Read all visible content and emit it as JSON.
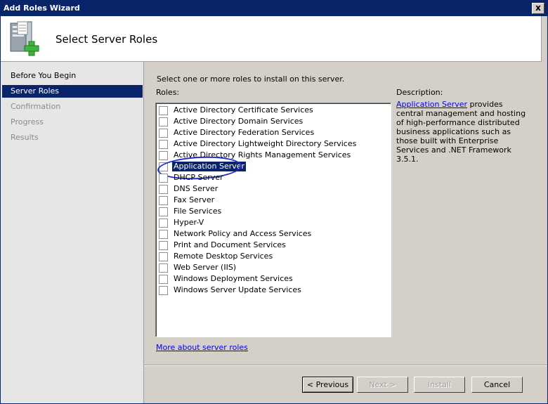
{
  "window": {
    "title": "Add Roles Wizard",
    "close_label": "x"
  },
  "header": {
    "title": "Select Server Roles"
  },
  "nav": {
    "items": [
      {
        "label": "Before You Begin",
        "state": "normal"
      },
      {
        "label": "Server Roles",
        "state": "active"
      },
      {
        "label": "Confirmation",
        "state": "disabled"
      },
      {
        "label": "Progress",
        "state": "disabled"
      },
      {
        "label": "Results",
        "state": "disabled"
      }
    ]
  },
  "content": {
    "instruction": "Select one or more roles to install on this server.",
    "roles_label": "Roles:",
    "roles": [
      {
        "label": "Active Directory Certificate Services",
        "checked": false,
        "selected": false
      },
      {
        "label": "Active Directory Domain Services",
        "checked": false,
        "selected": false
      },
      {
        "label": "Active Directory Federation Services",
        "checked": false,
        "selected": false
      },
      {
        "label": "Active Directory Lightweight Directory Services",
        "checked": false,
        "selected": false
      },
      {
        "label": "Active Directory Rights Management Services",
        "checked": false,
        "selected": false
      },
      {
        "label": "Application Server",
        "checked": false,
        "selected": true
      },
      {
        "label": "DHCP Server",
        "checked": false,
        "selected": false
      },
      {
        "label": "DNS Server",
        "checked": false,
        "selected": false
      },
      {
        "label": "Fax Server",
        "checked": false,
        "selected": false
      },
      {
        "label": "File Services",
        "checked": false,
        "selected": false
      },
      {
        "label": "Hyper-V",
        "checked": false,
        "selected": false
      },
      {
        "label": "Network Policy and Access Services",
        "checked": false,
        "selected": false
      },
      {
        "label": "Print and Document Services",
        "checked": false,
        "selected": false
      },
      {
        "label": "Remote Desktop Services",
        "checked": false,
        "selected": false
      },
      {
        "label": "Web Server (IIS)",
        "checked": false,
        "selected": false
      },
      {
        "label": "Windows Deployment Services",
        "checked": false,
        "selected": false
      },
      {
        "label": "Windows Server Update Services",
        "checked": false,
        "selected": false
      }
    ],
    "description_label": "Description:",
    "description_link": "Application Server",
    "description_text": " provides central management and hosting of high-performance distributed business applications such as those built with Enterprise Services and .NET Framework 3.5.1.",
    "more_link": "More about server roles"
  },
  "footer": {
    "previous": "< Previous",
    "next": "Next >",
    "install": "Install",
    "cancel": "Cancel"
  },
  "colors": {
    "title_bar": "#0a246a",
    "selection": "#0a246a",
    "link": "#0000ee",
    "annotation": "#1e2ccc"
  }
}
